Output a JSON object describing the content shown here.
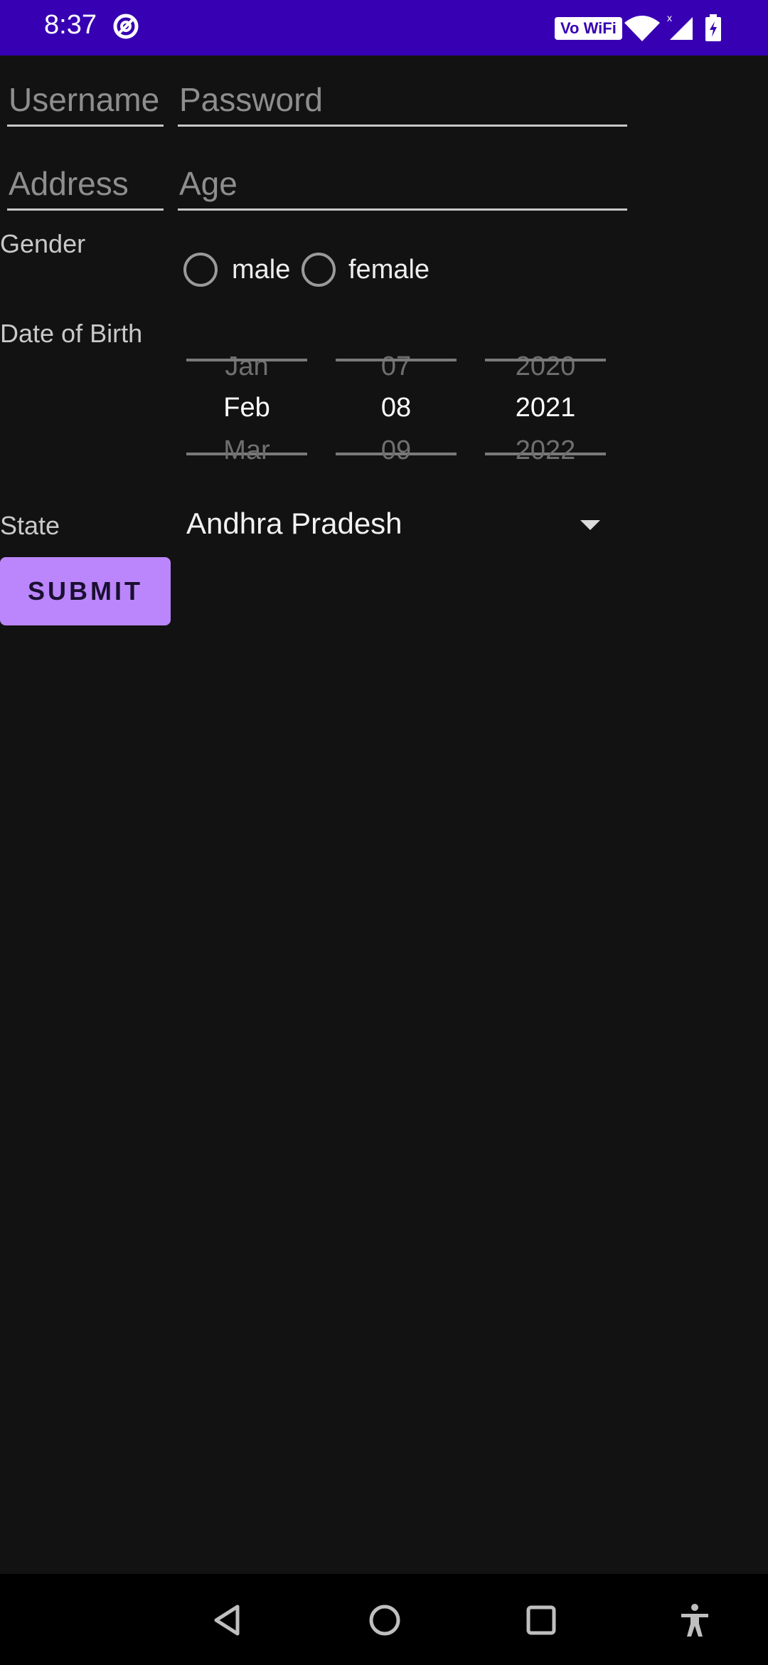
{
  "status_bar": {
    "time": "8:37",
    "network_badge": "Vo WiFi",
    "icons": [
      "do-not-disturb-icon",
      "wifi-icon",
      "signal-icon",
      "battery-charging-icon"
    ]
  },
  "form": {
    "username": {
      "placeholder": "Username"
    },
    "password": {
      "placeholder": "Password"
    },
    "address": {
      "placeholder": "Address"
    },
    "age": {
      "placeholder": "Age"
    },
    "gender_label": "Gender",
    "gender_options": [
      "male",
      "female"
    ],
    "dob_label": "Date of Birth",
    "dob_picker": {
      "month": {
        "prev": "Jan",
        "selected": "Feb",
        "next": "Mar"
      },
      "day": {
        "prev": "07",
        "selected": "08",
        "next": "09"
      },
      "year": {
        "prev": "2020",
        "selected": "2021",
        "next": "2022"
      }
    },
    "state_label": "State",
    "state_value": "Andhra Pradesh",
    "submit_label": "SUBMIT"
  },
  "nav_bar": {
    "icons": [
      "back-icon",
      "home-icon",
      "recents-icon",
      "accessibility-icon"
    ]
  },
  "colors": {
    "status_bar": "#3700b3",
    "background": "#121212",
    "accent": "#bb86fc"
  }
}
